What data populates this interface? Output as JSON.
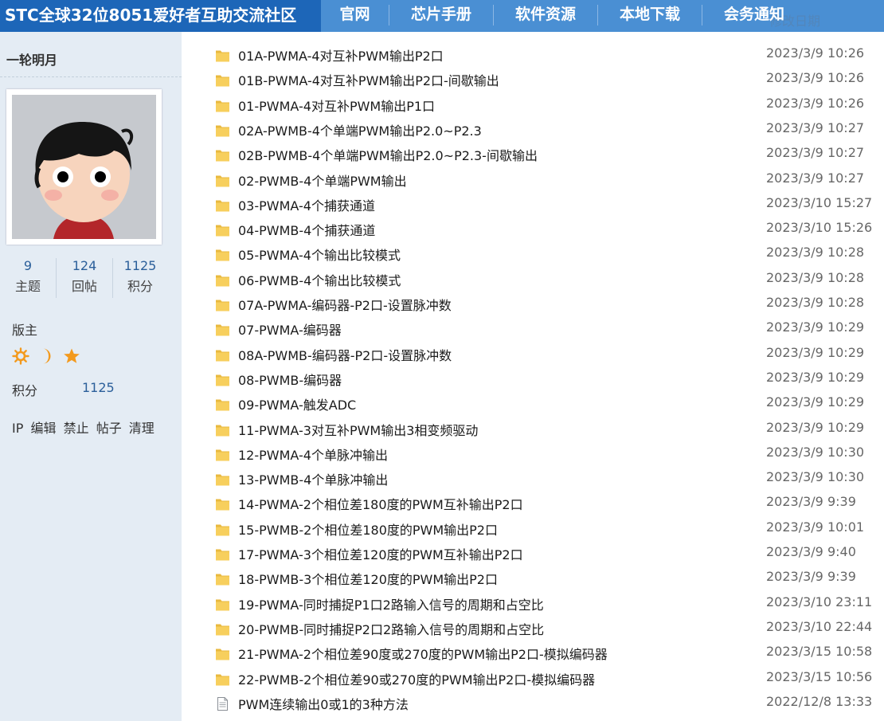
{
  "header": {
    "site_title": "STC全球32位8051爱好者互助交流社区",
    "nav": [
      "官网",
      "芯片手册",
      "软件资源",
      "本地下载",
      "会务通知"
    ],
    "faded_column_header": "修改日期"
  },
  "sidebar": {
    "username": "一轮明月",
    "stats": [
      {
        "value": "9",
        "label": "主题"
      },
      {
        "value": "124",
        "label": "回帖"
      },
      {
        "value": "1125",
        "label": "积分"
      }
    ],
    "role": "版主",
    "rank_icons": [
      "sun-icon",
      "moon-icon",
      "star-icon"
    ],
    "points_label": "积分",
    "points_value": "1125",
    "admin_links": [
      "IP",
      "编辑",
      "禁止",
      "帖子",
      "清理"
    ]
  },
  "files": [
    {
      "name": "01A-PWMA-4对互补PWM输出P2口",
      "date": "2023/3/9 10:26",
      "type": "folder"
    },
    {
      "name": "01B-PWMA-4对互补PWM输出P2口-间歇输出",
      "date": "2023/3/9 10:26",
      "type": "folder"
    },
    {
      "name": "01-PWMA-4对互补PWM输出P1口",
      "date": "2023/3/9 10:26",
      "type": "folder"
    },
    {
      "name": "02A-PWMB-4个单端PWM输出P2.0~P2.3",
      "date": "2023/3/9 10:27",
      "type": "folder"
    },
    {
      "name": "02B-PWMB-4个单端PWM输出P2.0~P2.3-间歇输出",
      "date": "2023/3/9 10:27",
      "type": "folder"
    },
    {
      "name": "02-PWMB-4个单端PWM输出",
      "date": "2023/3/9 10:27",
      "type": "folder"
    },
    {
      "name": "03-PWMA-4个捕获通道",
      "date": "2023/3/10 15:27",
      "type": "folder"
    },
    {
      "name": "04-PWMB-4个捕获通道",
      "date": "2023/3/10 15:26",
      "type": "folder"
    },
    {
      "name": "05-PWMA-4个输出比较模式",
      "date": "2023/3/9 10:28",
      "type": "folder"
    },
    {
      "name": "06-PWMB-4个输出比较模式",
      "date": "2023/3/9 10:28",
      "type": "folder"
    },
    {
      "name": "07A-PWMA-编码器-P2口-设置脉冲数",
      "date": "2023/3/9 10:28",
      "type": "folder"
    },
    {
      "name": "07-PWMA-编码器",
      "date": "2023/3/9 10:29",
      "type": "folder"
    },
    {
      "name": "08A-PWMB-编码器-P2口-设置脉冲数",
      "date": "2023/3/9 10:29",
      "type": "folder"
    },
    {
      "name": "08-PWMB-编码器",
      "date": "2023/3/9 10:29",
      "type": "folder"
    },
    {
      "name": "09-PWMA-触发ADC",
      "date": "2023/3/9 10:29",
      "type": "folder"
    },
    {
      "name": "11-PWMA-3对互补PWM输出3相变频驱动",
      "date": "2023/3/9 10:29",
      "type": "folder"
    },
    {
      "name": "12-PWMA-4个单脉冲输出",
      "date": "2023/3/9 10:30",
      "type": "folder"
    },
    {
      "name": "13-PWMB-4个单脉冲输出",
      "date": "2023/3/9 10:30",
      "type": "folder"
    },
    {
      "name": "14-PWMA-2个相位差180度的PWM互补输出P2口",
      "date": "2023/3/9 9:39",
      "type": "folder"
    },
    {
      "name": "15-PWMB-2个相位差180度的PWM输出P2口",
      "date": "2023/3/9 10:01",
      "type": "folder"
    },
    {
      "name": "17-PWMA-3个相位差120度的PWM互补输出P2口",
      "date": "2023/3/9 9:40",
      "type": "folder"
    },
    {
      "name": "18-PWMB-3个相位差120度的PWM输出P2口",
      "date": "2023/3/9 9:39",
      "type": "folder"
    },
    {
      "name": "19-PWMA-同时捕捉P1口2路输入信号的周期和占空比",
      "date": "2023/3/10 23:11",
      "type": "folder"
    },
    {
      "name": "20-PWMB-同时捕捉P2口2路输入信号的周期和占空比",
      "date": "2023/3/10 22:44",
      "type": "folder"
    },
    {
      "name": "21-PWMA-2个相位差90度或270度的PWM输出P2口-模拟编码器",
      "date": "2023/3/15 10:58",
      "type": "folder"
    },
    {
      "name": "22-PWMB-2个相位差90或270度的PWM输出P2口-模拟编码器",
      "date": "2023/3/15 10:56",
      "type": "folder"
    },
    {
      "name": "PWM连续输出0或1的3种方法",
      "date": "2022/12/8 13:33",
      "type": "document"
    }
  ],
  "colors": {
    "nav_bg": "#4a8fd3",
    "title_bg": "#1d66b8",
    "sidebar_bg": "#e4ecf4",
    "folder": "#f7cf5d",
    "link": "#2b5f9a"
  }
}
